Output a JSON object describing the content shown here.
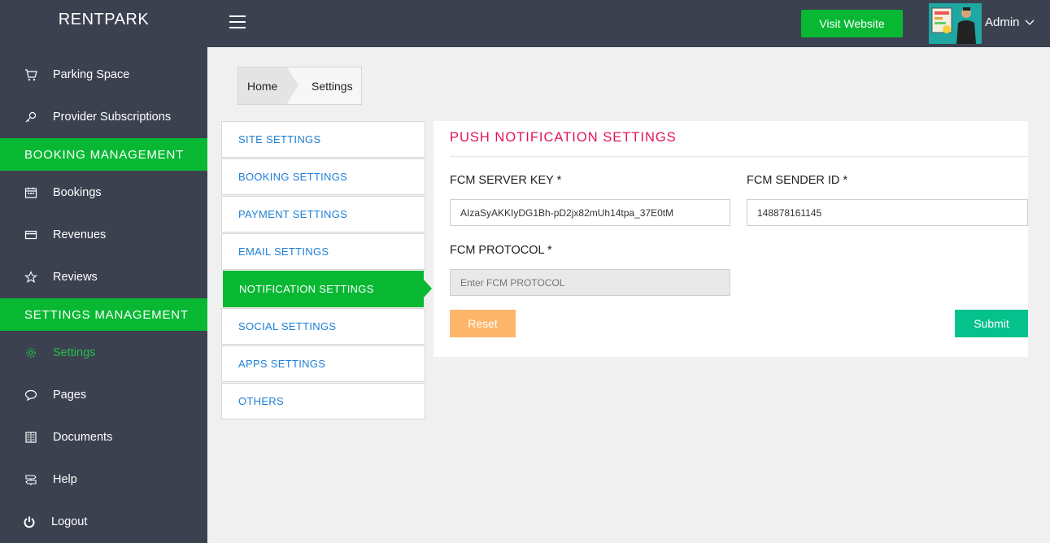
{
  "app": {
    "brand": "RENTPARK"
  },
  "header": {
    "visit_label": "Visit Website",
    "user_name": "Admin"
  },
  "sidebar": {
    "items": [
      {
        "label": "Parking Space",
        "icon": "cart-icon"
      },
      {
        "label": "Provider Subscriptions",
        "icon": "key-icon"
      },
      {
        "label": "Bookings",
        "icon": "calendar-icon"
      },
      {
        "label": "Revenues",
        "icon": "credit-card-icon"
      },
      {
        "label": "Reviews",
        "icon": "star-icon"
      },
      {
        "label": "Settings",
        "icon": "gear-icon",
        "active": true
      },
      {
        "label": "Pages",
        "icon": "chat-bubble-icon"
      },
      {
        "label": "Documents",
        "icon": "book-icon"
      },
      {
        "label": "Help",
        "icon": "signpost-icon"
      },
      {
        "label": "Logout",
        "icon": "power-icon"
      }
    ],
    "sections": [
      "BOOKING MANAGEMENT",
      "SETTINGS MANAGEMENT"
    ]
  },
  "breadcrumb": {
    "home": "Home",
    "current": "Settings"
  },
  "tabs": [
    "SITE SETTINGS",
    "BOOKING SETTINGS",
    "PAYMENT SETTINGS",
    "EMAIL SETTINGS",
    "NOTIFICATION SETTINGS",
    "SOCIAL SETTINGS",
    "APPS SETTINGS",
    "OTHERS"
  ],
  "panel": {
    "title": "PUSH NOTIFICATION SETTINGS",
    "server_key_label": "FCM SERVER KEY *",
    "server_key_value": "AIzaSyAKKIyDG1Bh-pD2jx82mUh14tpa_37E0tM",
    "sender_id_label": "FCM SENDER ID *",
    "sender_id_value": "148878161145",
    "protocol_label": "FCM PROTOCOL *",
    "protocol_placeholder": "Enter FCM PROTOCOL",
    "reset_label": "Reset",
    "submit_label": "Submit"
  },
  "colors": {
    "sidebar_bg": "#3c4150",
    "accent_green": "#08b833",
    "title_pink": "#e2125b",
    "link_blue": "#1f7fd6",
    "reset_orange": "#fdb56a",
    "submit_teal": "#05c18c"
  }
}
